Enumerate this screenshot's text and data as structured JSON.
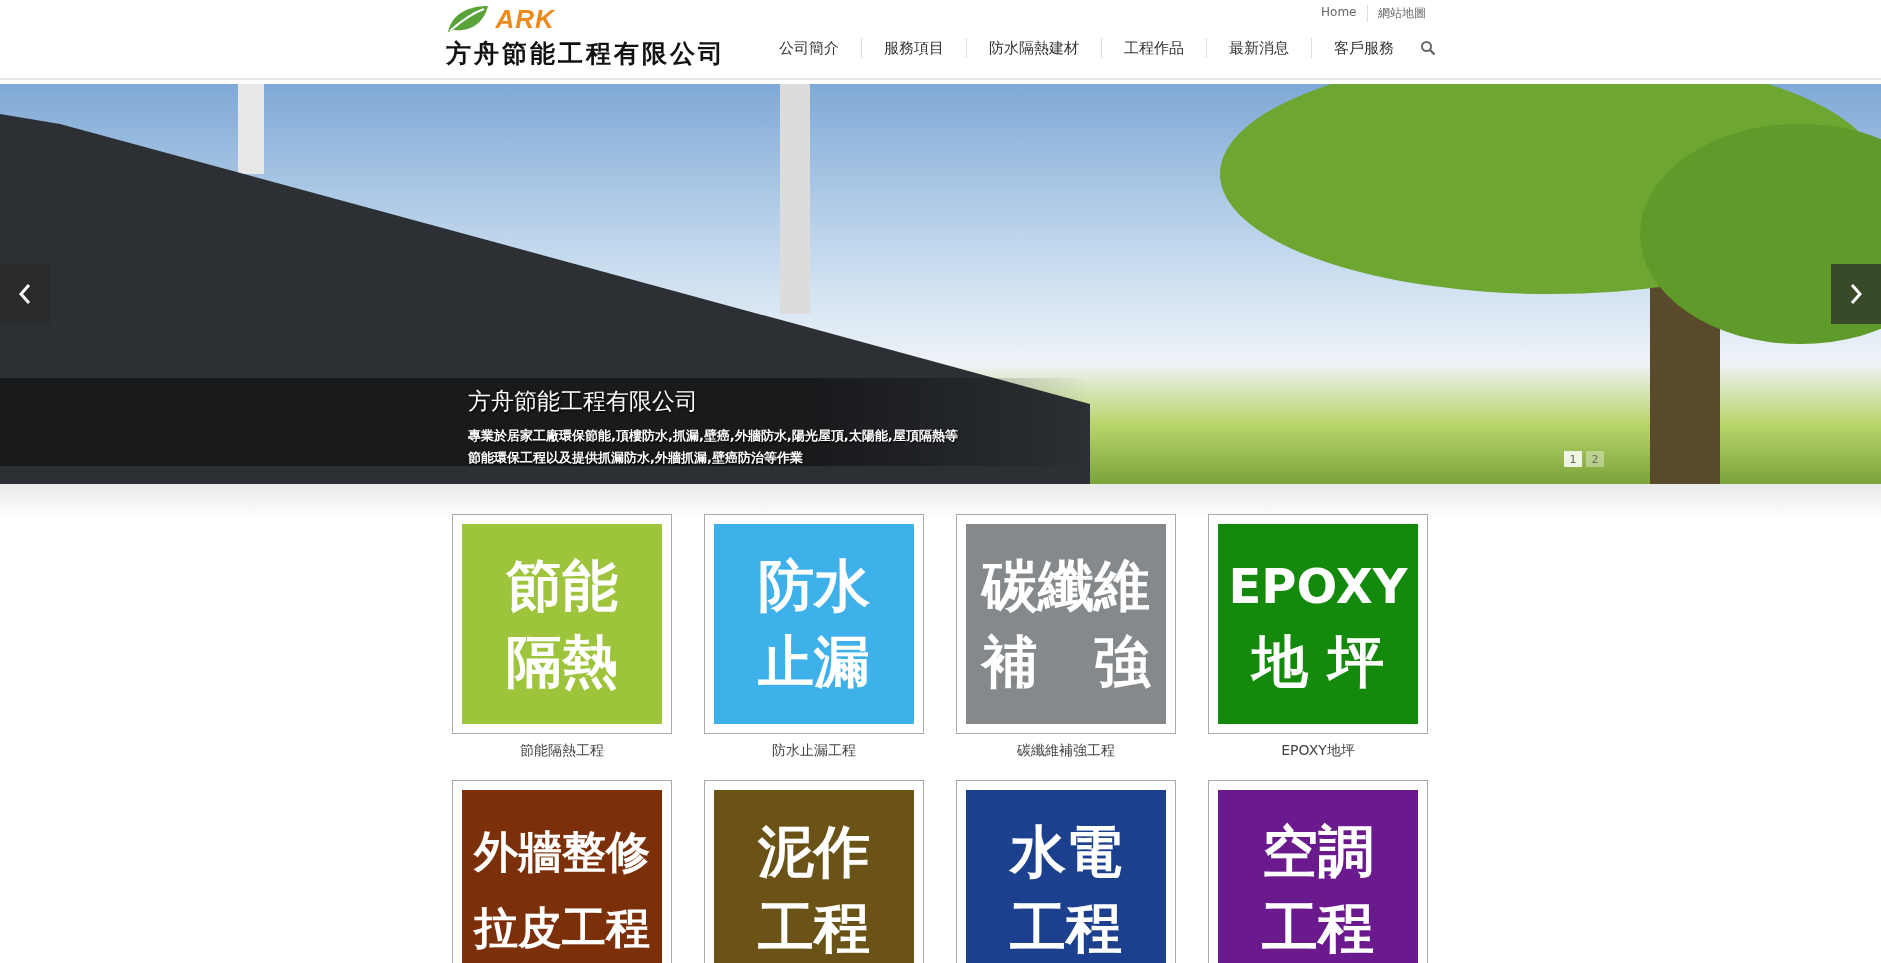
{
  "header": {
    "logo_mark": "ARK",
    "company_name": "方舟節能工程有限公司",
    "top_links": [
      "Home",
      "網站地圖"
    ],
    "nav": [
      "公司簡介",
      "服務項目",
      "防水隔熱建材",
      "工程作品",
      "最新消息",
      "客戶服務"
    ]
  },
  "banner": {
    "title": "方舟節能工程有限公司",
    "lines": [
      "專業於居家工廠環保節能,頂樓防水,抓漏,壁癌,外牆防水,陽光屋頂,太陽能,屋頂隔熱等",
      "節能環保工程以及提供抓漏防水,外牆抓漏,壁癌防治等作業"
    ],
    "pager": [
      {
        "label": "1",
        "selected": true
      },
      {
        "label": "2",
        "selected": false
      }
    ]
  },
  "services": [
    {
      "lines": [
        "節能",
        "隔熱"
      ],
      "caption": "節能隔熱工程",
      "color": "#9dc43b"
    },
    {
      "lines": [
        "防水",
        "止漏"
      ],
      "caption": "防水止漏工程",
      "color": "#3eb1ea"
    },
    {
      "lines": [
        "碳纖維",
        "補　強"
      ],
      "caption": "碳纖維補強工程",
      "color": "#85898c"
    },
    {
      "lines": [
        "EPOXY",
        "地 坪"
      ],
      "caption": "EPOXY地坪",
      "color": "#138a0b"
    },
    {
      "lines": [
        "外牆整修",
        "拉皮工程"
      ],
      "color": "#7c300a"
    },
    {
      "lines": [
        "泥作",
        "工程"
      ],
      "color": "#6b5318"
    },
    {
      "lines": [
        "水電",
        "工程"
      ],
      "color": "#1c3f8e"
    },
    {
      "lines": [
        "空調",
        "工程"
      ],
      "color": "#6a1a8c"
    }
  ]
}
